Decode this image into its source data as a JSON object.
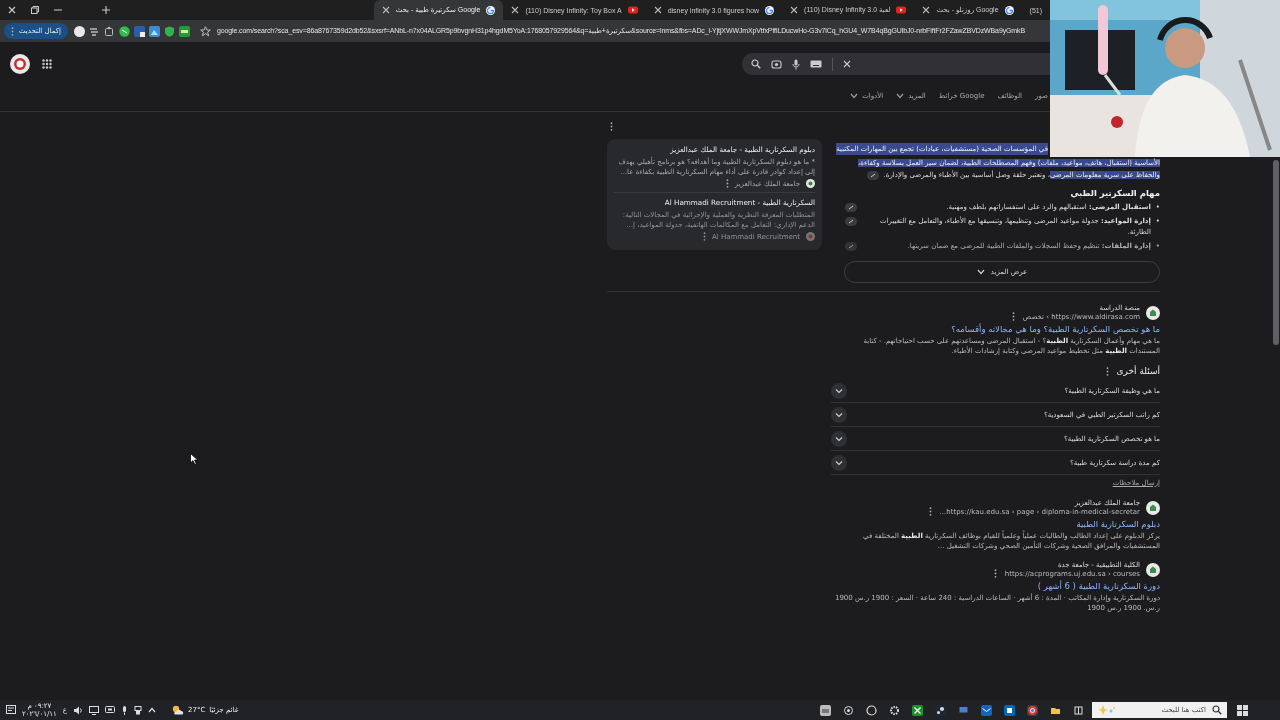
{
  "browser": {
    "tabs": [
      {
        "title": "(51)",
        "selected": false
      },
      {
        "title": "روزنلو - بحث Google",
        "video": false,
        "selected": false
      },
      {
        "title": "(110) Disney Infinity 3.0 لعبة",
        "video": true,
        "selected": false
      },
      {
        "title": "disney infinity 3.0 figures how",
        "video": false,
        "selected": false
      },
      {
        "title": "(110) Disney Infinity: Toy Box A",
        "video": true,
        "selected": false
      },
      {
        "title": "سكرتيرة طبية - بحث Google",
        "video": false,
        "selected": true
      }
    ],
    "update_button": "إكمال التحديث",
    "url": "google.com/search?sca_esv=86a8767359d2db52&sxsrf=ANbL-n7x04ALGR5p9bvgnH31p4hgdM5YoA:1768057929564&q=سكرتيرة+طبية&source=lnms&fbs=ADc_l-YjtjXWWJmXpVtfxPfflLDucwHo-G3v7lCq_hGU4_W7B4qBgGUlbJ0-nrbFiftFr2FZawZBVDzWBa9yGmkB"
  },
  "search_nav": [
    {
      "label": "صور",
      "dropdown": false
    },
    {
      "label": "الوظائف",
      "dropdown": false
    },
    {
      "label": "خرائط Google",
      "dropdown": false
    },
    {
      "label": "المزيد",
      "dropdown": true
    },
    {
      "label": "الأدوات",
      "dropdown": true
    }
  ],
  "overview": {
    "clipped_line": {
      "text": "في المؤسسات الصحية (مستشفيات، عيادات) تجمع بين المهارات المكتبية",
      "selected": true
    },
    "parts": [
      {
        "text": "الأساسية (استقبال، هاتف، مواعيد، ملفات) وفهم المصطلحات الطبية، لضمان سير العمل بسلاسة وكفاءة، والحفاظ على سرية معلومات المرضى",
        "selected": true
      },
      {
        "text": "، وتعتبر حلقة وصل أساسية بين الأطباء والمرضى والإدارة.",
        "selected": false
      }
    ],
    "heading": "مهام السكرتير الطبي",
    "bullets": [
      {
        "marker": "•",
        "text": "**استقبال المرضى:** استقبالهم والرد على استفساراتهم بلطف ومهنية."
      },
      {
        "marker": "•",
        "text": "**إدارة المواعيد:** جدولة مواعيد المرضى وتنظيمها، وتنسيقها مع الأطباء، والتعامل مع التغييرات الطارئة."
      },
      {
        "marker": "•",
        "text": "**إدارة الملفات:** تنظيم وحفظ السجلات والملفات الطبية للمرضى مع ضمان سريتها."
      }
    ],
    "show_more": "عرض المزيد",
    "sources": [
      {
        "title": "دبلوم السكرتارية الطبية - جامعة الملك عبدالعزيز",
        "snippet": "* ما هو دبلوم السكرتارية الطبية وما أهدافه؟ هو برنامج تأهيلي يهدف إلى إعداد كوادر قادرة على أداء مهام السكرتارية الطبية بكفاءة عا...",
        "site": "جامعة الملك عبدالعزيز",
        "faded": false
      },
      {
        "title": "السكرتارية الطبية - Al Hammadi Recruitment",
        "snippet": "المتطلبات المعرفة النظرية والعملية والإجرائية في المجالات التالية: الدعم الإداري: التعامل مع المكالمات الهاتفية، جدولة المواعيد، إ...",
        "site": "Al Hammadi Recruitment",
        "faded": true
      }
    ]
  },
  "results_top": [
    {
      "site": "منصة الدراسة",
      "url": "https://www.aldirasa.com › تخصص",
      "title": "ما هو تخصص السكرتارية الطبية؟ وما هي مجالاته وأقسامه؟",
      "snippet": "ما هي مهام وأعمال السكرتارية **الطبية**؟ - استقبال المرضى ومساعدتهم على حسب احتياجاتهم. - كتابة المستندات **الطبية** مثل تخطيط مواعيد المرضى وكتابة إرشادات الأطباء."
    }
  ],
  "people_also_ask": {
    "title": "أسئلة أخرى",
    "questions": [
      {
        "text": "ما هي وظيفة السكرتارية الطبية؟",
        "expanded": false
      },
      {
        "text": "كم راتب السكرتير الطبي في السعودية؟",
        "expanded": false
      },
      {
        "text": "ما هو تخصص السكرتارية الطبية؟",
        "expanded": false
      },
      {
        "text": "كم مدة دراسة سكرتارية طبية؟",
        "expanded": false
      }
    ],
    "feedback": "إرسال ملاحظات"
  },
  "results": [
    {
      "site": "جامعة الملك عبدالعزيز",
      "url": "https://kau.edu.sa › page › diploma-in-medical-secretar...",
      "title": "دبلوم السكرتارية الطبية",
      "snippet": "يركز الدبلوم على إعداد الطالب والطالبات عملياً وعلمياً للقيام بوظائف السكرتارية **الطبية** المختلفة في المستشفيات والمرافق الصحية وشركات التأمين الصحي وشركات التشغيل ..."
    },
    {
      "site": "الكلية التطبيقية - جامعة جدة",
      "url": "https://acprograms.uj.edu.sa › courses",
      "title": "دورة السكرتارية الطبية ( 6 أشهر )",
      "snippet": "دورة السكرتارية وإدارة المكاتب · المدة : 6 أشهر · الساعات الدراسية : 240 ساعة · السعر : 1900 ر.س 1900 ر.س. 1900 ر.س 1900"
    }
  ],
  "taskbar": {
    "time": "٠٩:٢٧ م",
    "date": "٢٠٢٦/٠١/١١",
    "language": "ع",
    "temperature": "27°C",
    "weather": "غائم جزئيًا",
    "search_placeholder": "اكتب هنا للبحث"
  }
}
